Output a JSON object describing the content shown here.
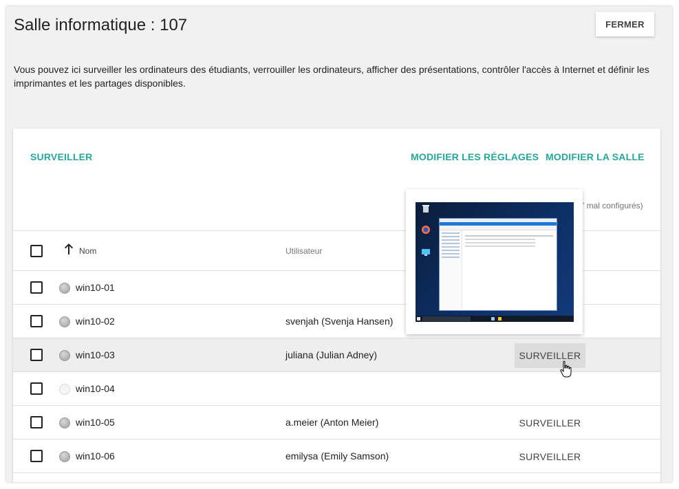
{
  "page": {
    "title": "Salle informatique : 107",
    "close_label": "FERMER",
    "description": "Vous pouvez ici surveiller les ordinateurs des étudiants, verrouiller les ordinateurs, afficher des présentations, contrôler l'accès à Internet et définir les imprimantes et les partages disponibles."
  },
  "toolbar": {
    "monitor_label": "SURVEILLER",
    "settings_label": "MODIFIER LES RÉGLAGES",
    "room_label": "MODIFIER LA SALLE",
    "hint_text": "' mal configurés)"
  },
  "table": {
    "col_name": "Nom",
    "col_user": "Utilisateur",
    "rows": [
      {
        "name": "win10-01",
        "user": "",
        "action": "",
        "online": true
      },
      {
        "name": "win10-02",
        "user": "svenjah (Svenja Hansen)",
        "action": "",
        "online": true
      },
      {
        "name": "win10-03",
        "user": "juliana (Julian Adney)",
        "action": "SURVEILLER",
        "online": true
      },
      {
        "name": "win10-04",
        "user": "",
        "action": "",
        "online": false
      },
      {
        "name": "win10-05",
        "user": "a.meier (Anton Meier)",
        "action": "SURVEILLER",
        "online": true
      },
      {
        "name": "win10-06",
        "user": "emilysa (Emily Samson)",
        "action": "SURVEILLER",
        "online": true
      }
    ]
  },
  "popover": {
    "icons": [
      "recycle-bin-icon",
      "firefox-icon",
      "computer-icon"
    ]
  },
  "colors": {
    "accent": "#26a69a",
    "background": "#f1f1f1",
    "row_highlight": "#eeeeee"
  }
}
